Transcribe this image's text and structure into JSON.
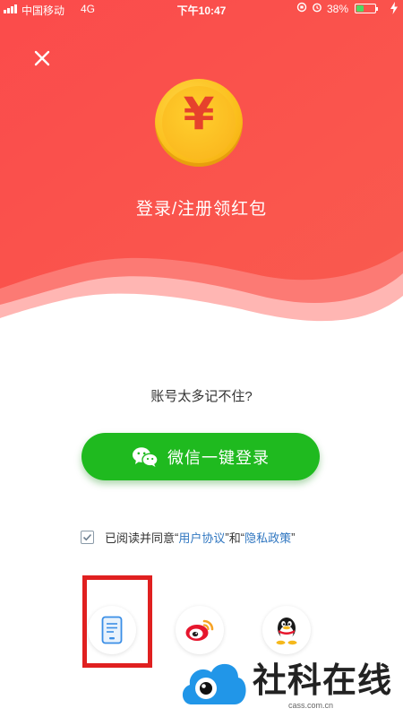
{
  "status_bar": {
    "carrier": "中国移动",
    "network": "4G",
    "time": "下午10:47",
    "battery_percent": "38%",
    "battery_level": 0.38
  },
  "promo": {
    "coin_symbol": "¥",
    "title": "登录/注册领红包"
  },
  "login": {
    "account_hint": "账号太多记不住?",
    "wechat_button_label": "微信一键登录"
  },
  "agreement": {
    "prefix": "已阅读并同意",
    "open_quote_1": "“",
    "user_agreement": "用户协议",
    "close_quote_1": "”",
    "conjunction": "和",
    "open_quote_2": "“",
    "privacy_policy": "隐私政策",
    "close_quote_2": "”",
    "checked": true
  },
  "other_logins": [
    {
      "icon": "phone-icon"
    },
    {
      "icon": "weibo-icon"
    },
    {
      "icon": "qq-icon"
    }
  ],
  "watermark": {
    "brand": "社科在线",
    "url": "cass.com.cn"
  },
  "colors": {
    "header_red": "#fa4d4b",
    "wechat_green": "#1fba1f",
    "link_blue": "#2f76c0",
    "coin_gold": "#fbbf1c",
    "highlight_red": "#e02020"
  }
}
